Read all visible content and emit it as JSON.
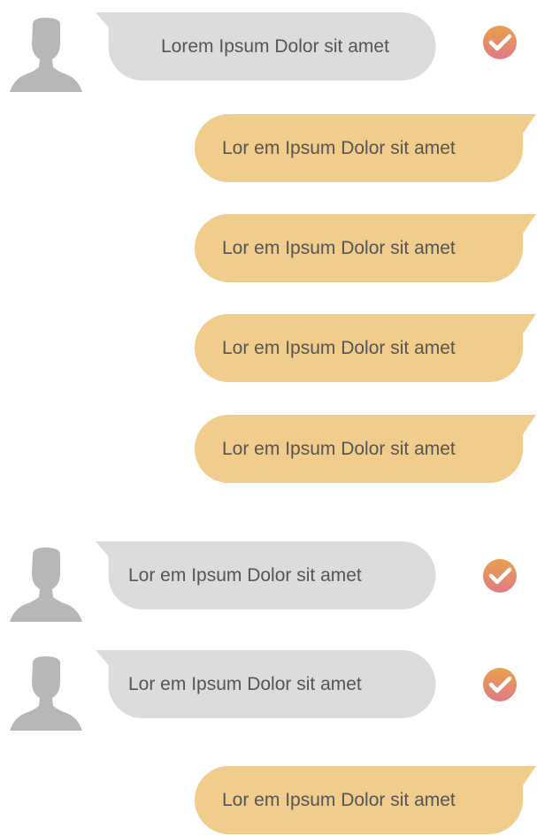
{
  "colors": {
    "incoming_bubble": "#dcdcdc",
    "outgoing_bubble": "#f0cd8c",
    "avatar": "#b7b7b7",
    "check_top": "#e9a14b",
    "check_bottom": "#e07a86",
    "text": "#555555"
  },
  "messages": [
    {
      "direction": "incoming",
      "text": "Lorem Ipsum Dolor sit amet",
      "status_icon": "check-circle-icon"
    },
    {
      "direction": "outgoing",
      "text": "Lor em Ipsum Dolor sit amet"
    },
    {
      "direction": "outgoing",
      "text": "Lor em Ipsum Dolor sit amet"
    },
    {
      "direction": "outgoing",
      "text": "Lor em Ipsum Dolor sit amet"
    },
    {
      "direction": "outgoing",
      "text": "Lor em Ipsum Dolor sit amet"
    },
    {
      "direction": "incoming",
      "text": "Lor em Ipsum Dolor sit amet",
      "status_icon": "check-circle-icon"
    },
    {
      "direction": "incoming",
      "text": "Lor em Ipsum Dolor sit amet",
      "status_icon": "check-circle-icon"
    },
    {
      "direction": "outgoing",
      "text": "Lor em Ipsum Dolor sit amet"
    }
  ]
}
